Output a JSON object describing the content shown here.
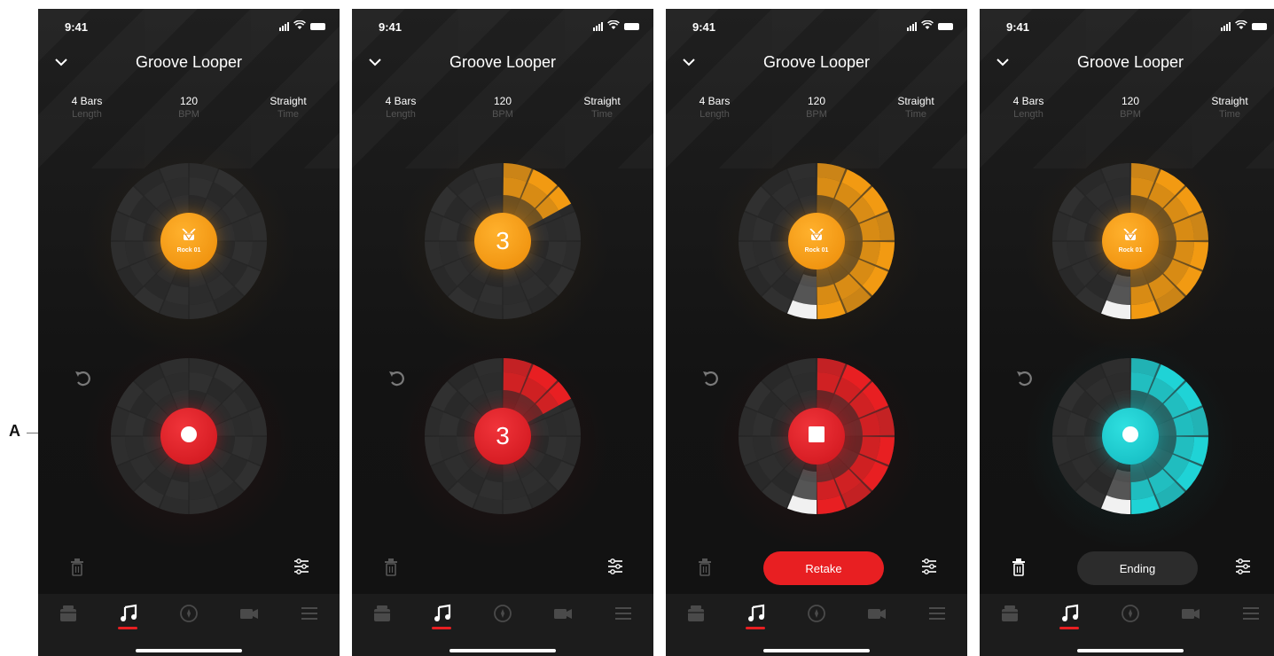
{
  "annotation": {
    "label": "A"
  },
  "screens": [
    {
      "status_time": "9:41",
      "title": "Groove Looper",
      "info": [
        {
          "value": "4 Bars",
          "label": "Length"
        },
        {
          "value": "120",
          "label": "BPM"
        },
        {
          "value": "Straight",
          "label": "Time"
        }
      ],
      "drum": {
        "label": "Rock 01",
        "progress": 0
      },
      "record": {
        "state": "record",
        "progress": 0
      },
      "bottom_pill": null
    },
    {
      "status_time": "9:41",
      "title": "Groove Looper",
      "info": [
        {
          "value": "4 Bars",
          "label": "Length"
        },
        {
          "value": "120",
          "label": "BPM"
        },
        {
          "value": "Straight",
          "label": "Time"
        }
      ],
      "drum": {
        "count": "3",
        "progress": 0.17
      },
      "record": {
        "state": "countdown",
        "count": "3",
        "progress": 0.17
      },
      "bottom_pill": null
    },
    {
      "status_time": "9:41",
      "title": "Groove Looper",
      "info": [
        {
          "value": "4 Bars",
          "label": "Length"
        },
        {
          "value": "120",
          "label": "BPM"
        },
        {
          "value": "Straight",
          "label": "Time"
        }
      ],
      "drum": {
        "label": "Rock 01",
        "progress": 0.5
      },
      "record": {
        "state": "stop",
        "progress": 0.5
      },
      "bottom_pill": "Retake"
    },
    {
      "status_time": "9:41",
      "title": "Groove Looper",
      "info": [
        {
          "value": "4 Bars",
          "label": "Length"
        },
        {
          "value": "120",
          "label": "BPM"
        },
        {
          "value": "Straight",
          "label": "Time"
        }
      ],
      "drum": {
        "label": "Rock 01",
        "progress": 0.5
      },
      "record": {
        "state": "play",
        "progress": 0.5
      },
      "bottom_pill": "Ending"
    }
  ],
  "colors": {
    "orange": "#F29A12",
    "red": "#E81F22",
    "cyan": "#1FD3D6",
    "background": "#151515"
  },
  "tabs": [
    "presets-icon",
    "music-note-icon",
    "compass-icon",
    "video-camera-icon",
    "menu-icon"
  ],
  "active_tab": 1
}
